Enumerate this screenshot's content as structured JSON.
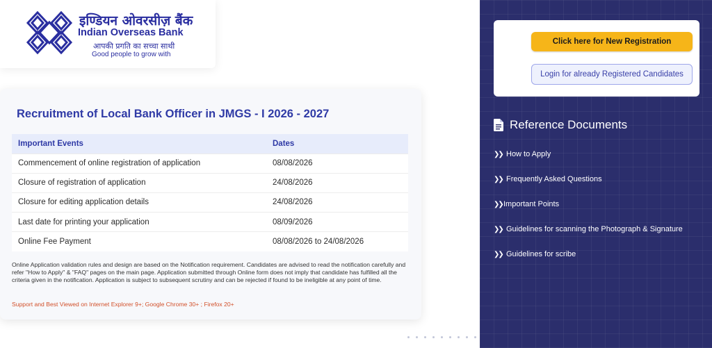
{
  "bank": {
    "name_hindi": "इण्डियन ओवरसीज़ बैंक",
    "name_english": "Indian Overseas Bank",
    "tagline_hindi": "आपकी प्रगति का सच्चा साथी",
    "tagline_english": "Good people to grow with",
    "logo_icon": "iob-logo-icon",
    "brand_color": "#2a2ea0"
  },
  "main": {
    "title": "Recruitment of Local Bank Officer in JMGS - I 2026 - 2027",
    "table": {
      "headers": [
        "Important Events",
        "Dates"
      ],
      "rows": [
        [
          "Commencement of online registration of application",
          "08/08/2026"
        ],
        [
          "Closure of registration of application",
          "24/08/2026"
        ],
        [
          "Closure for editing application details",
          "24/08/2026"
        ],
        [
          "Last date for printing your application",
          "08/09/2026"
        ],
        [
          "Online Fee Payment",
          "08/08/2026 to 24/08/2026"
        ]
      ]
    },
    "note": "Online Application validation rules and design are based on the Notification requirement. Candidates are advised to read the notification carefully and refer \"How to Apply\" & \"FAQ\" pages on the main page. Application submitted through Online form does not imply that candidate has fulfilled all the criteria given in the notification. Application is subject to subsequent scrutiny and can be rejected if found to be ineligible at any point of time.",
    "support": "Support and Best Viewed on Internet Explorer 9+; Google Chrome 30+ ; Firefox 20+"
  },
  "sidebar": {
    "new_registration_label": "Click here for New Registration",
    "login_label": "Login for already Registered Candidates",
    "reference_title": "Reference Documents",
    "reference_icon": "document-icon",
    "items": [
      {
        "label": "How to Apply",
        "icon": "double-chevron-right-icon"
      },
      {
        "label": "Frequently Asked Questions",
        "icon": "double-chevron-right-icon"
      },
      {
        "label": "Important Points",
        "icon": "double-chevron-right-icon"
      },
      {
        "label": "Guidelines for scanning the Photograph & Signature",
        "icon": "double-chevron-right-icon"
      },
      {
        "label": "Guidelines for scribe",
        "icon": "double-chevron-right-icon"
      }
    ],
    "colors": {
      "panel": "#2b2e6c",
      "button": "#f6b519"
    }
  }
}
